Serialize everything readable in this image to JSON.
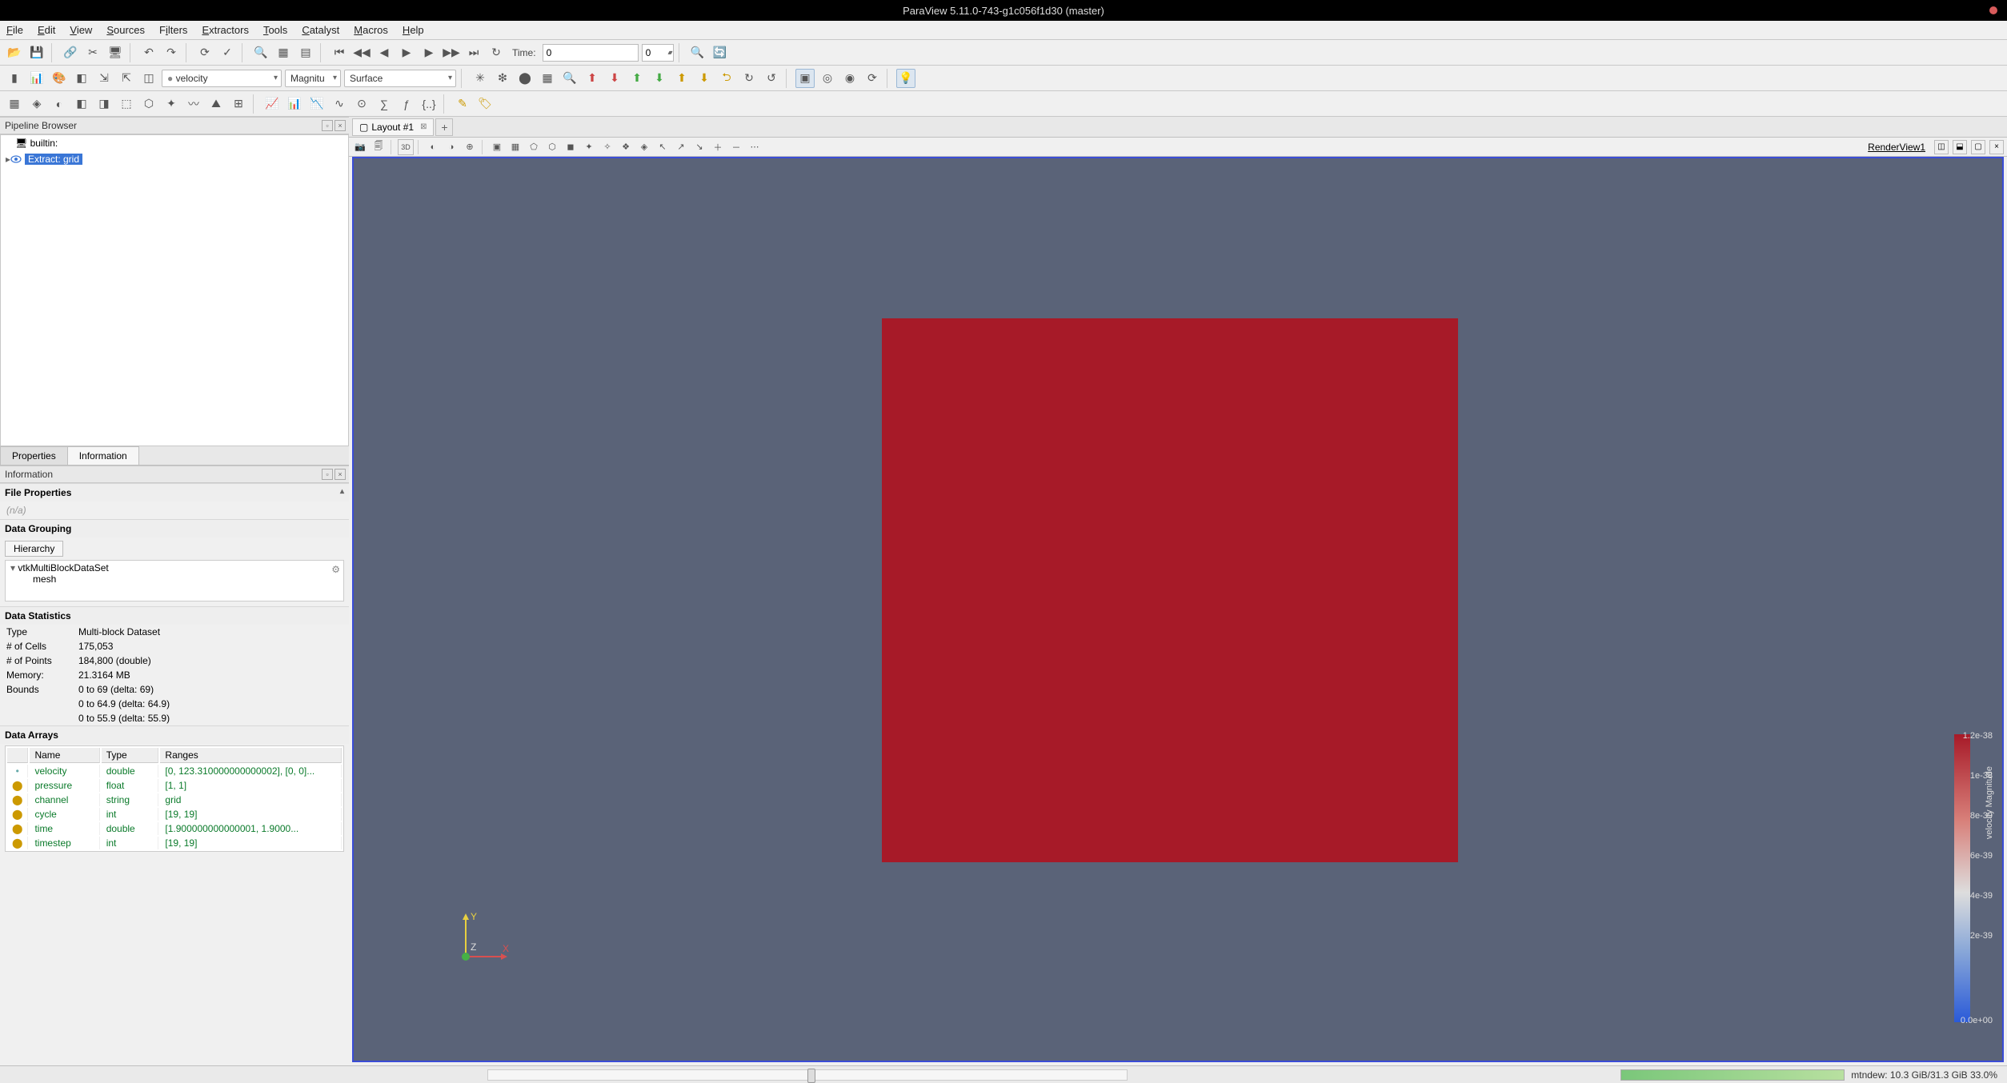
{
  "window": {
    "title": "ParaView 5.11.0-743-g1c056f1d30 (master)"
  },
  "menu": {
    "file": "File",
    "edit": "Edit",
    "view": "View",
    "sources": "Sources",
    "filters": "Filters",
    "extractors": "Extractors",
    "tools": "Tools",
    "catalyst": "Catalyst",
    "macros": "Macros",
    "help": "Help"
  },
  "toolbar1": {
    "time_label": "Time:",
    "time_value": "0",
    "time_index": "0"
  },
  "toolbar2": {
    "array": "velocity",
    "component": "Magnitu",
    "repr": "Surface"
  },
  "pipeline": {
    "title": "Pipeline Browser",
    "root": "builtin:",
    "item": "Extract: grid"
  },
  "tabs": {
    "properties": "Properties",
    "information": "Information"
  },
  "info": {
    "title": "Information",
    "file_props": "File Properties",
    "na": "(n/a)",
    "grouping": "Data Grouping",
    "hierarchy": "Hierarchy",
    "tree_root": "vtkMultiBlockDataSet",
    "tree_child": "mesh",
    "stats": "Data Statistics",
    "type_k": "Type",
    "type_v": "Multi-block Dataset",
    "cells_k": "# of Cells",
    "cells_v": "175,053",
    "points_k": "# of Points",
    "points_v": "184,800 (double)",
    "mem_k": "Memory:",
    "mem_v": "21.3164 MB",
    "bounds_k": "Bounds",
    "bounds_v1": "0 to 69 (delta: 69)",
    "bounds_v2": "0 to 64.9 (delta: 64.9)",
    "bounds_v3": "0 to 55.9 (delta: 55.9)",
    "arrays": "Data Arrays",
    "cols": {
      "name": "Name",
      "type": "Type",
      "ranges": "Ranges"
    },
    "rows": [
      {
        "sym": "•",
        "name": "velocity",
        "type": "double",
        "ranges": "[0, 123.310000000000002], [0, 0]..."
      },
      {
        "sym": "⬤",
        "name": "pressure",
        "type": "float",
        "ranges": "[1, 1]"
      },
      {
        "sym": "⬤",
        "name": "channel",
        "type": "string",
        "ranges": "grid"
      },
      {
        "sym": "⬤",
        "name": "cycle",
        "type": "int",
        "ranges": "[19, 19]"
      },
      {
        "sym": "⬤",
        "name": "time",
        "type": "double",
        "ranges": "[1.900000000000001, 1.9000..."
      },
      {
        "sym": "⬤",
        "name": "timestep",
        "type": "int",
        "ranges": "[19, 19]"
      }
    ]
  },
  "layout": {
    "tab": "Layout #1",
    "render_label": "RenderView1",
    "mode3d": "3D"
  },
  "colorbar": {
    "title": "velocity Magnitude",
    "ticks": [
      "1.2e-38",
      "1e-38",
      "8e-39",
      "6e-39",
      "4e-39",
      "2e-39",
      "0.0e+00"
    ]
  },
  "axis": {
    "x": "X",
    "y": "Y",
    "z": "Z"
  },
  "status": {
    "slider_val": "",
    "mem": "mtndew: 10.3 GiB/31.3 GiB 33.0%"
  }
}
